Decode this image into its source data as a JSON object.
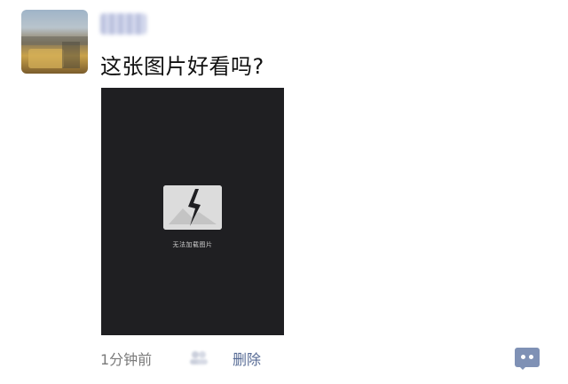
{
  "post": {
    "author_name": "",
    "text": "这张图片好看吗?",
    "image": {
      "fail_message": "无法加载图片"
    },
    "meta": {
      "time": "1分钟前",
      "delete_label": "删除"
    }
  },
  "icons": {
    "broken_image": "broken-image-icon",
    "privacy": "privacy-icon",
    "comment": "comment-icon"
  },
  "colors": {
    "link": "#576b95",
    "comment_button": "#7f91b5",
    "image_bg": "#1f1f22"
  }
}
